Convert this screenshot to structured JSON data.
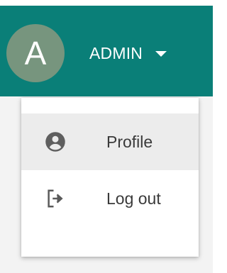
{
  "app_bar": {
    "avatar_letter": "A",
    "user_name": "ADMIN",
    "background_color": "#0a7f78",
    "avatar_color": "#77957e",
    "caret_icon": "caret-down-icon"
  },
  "menu": {
    "items": [
      {
        "label": "Profile",
        "icon": "account-circle-icon",
        "highlighted": true
      },
      {
        "label": "Log out",
        "icon": "logout-icon",
        "highlighted": false
      }
    ]
  }
}
